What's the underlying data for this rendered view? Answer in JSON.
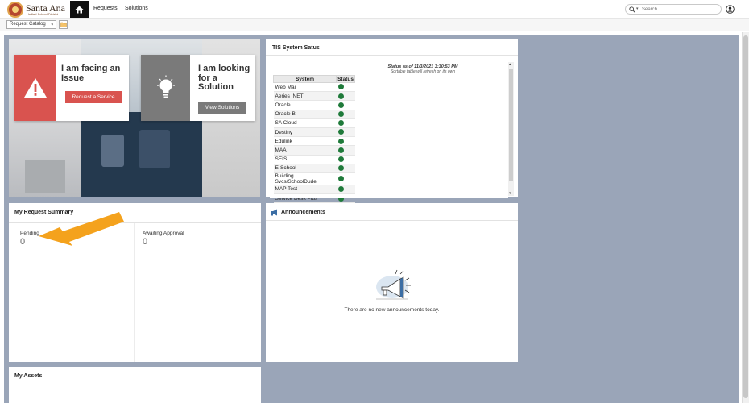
{
  "brand": {
    "name": "Santa Ana",
    "subtitle": "Unified School District"
  },
  "nav": {
    "requests": "Requests",
    "solutions": "Solutions"
  },
  "search": {
    "placeholder": "Search..."
  },
  "toolbar": {
    "catalog": "Request Catalog"
  },
  "hero": {
    "issue": {
      "title": "I am facing an Issue",
      "button": "Request a Service"
    },
    "solution": {
      "title": "I am looking for a Solution",
      "button": "View Solutions"
    }
  },
  "status": {
    "title": "TIS System Satus",
    "as_of": "Status as of 11/3/2021 3:30:53 PM",
    "note": "Sortable table will refresh on its own",
    "col_system": "System",
    "col_status": "Status",
    "rows": [
      "Web Mail",
      "Aeries .NET",
      "Oracle",
      "Oracle BI",
      "SA Cloud",
      "Destiny",
      "Edulink",
      "MAA",
      "SEIS",
      "E-School",
      "Building Svcs/SchoolDude",
      "MAP Test",
      "Service Desk Plus"
    ]
  },
  "summary": {
    "title": "My Request Summary",
    "pending_label": "Pending",
    "pending_value": "0",
    "approval_label": "Awaiting Approval",
    "approval_value": "0"
  },
  "announcements": {
    "title": "Announcements",
    "empty": "There are no new announcements today."
  },
  "assets": {
    "title": "My Assets"
  },
  "colors": {
    "accent_red": "#d9534f",
    "status_green": "#1f7a3a",
    "arrow": "#f4a21d",
    "page_bg": "#9aa5b8"
  }
}
